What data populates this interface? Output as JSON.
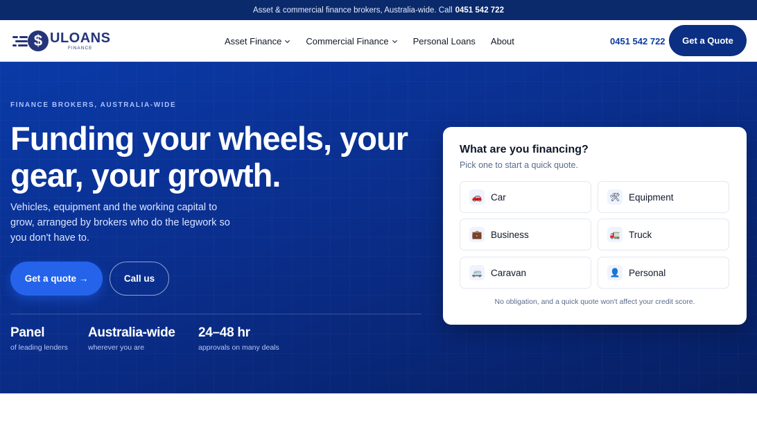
{
  "topbar": {
    "text": "Asset & commercial finance brokers, Australia-wide. Call",
    "phone": "0451 542 722"
  },
  "logo": {
    "mark": "$",
    "name": "ULOANS",
    "tagline": "FINANCE"
  },
  "nav": {
    "items": [
      {
        "label": "Asset Finance",
        "has_dropdown": true
      },
      {
        "label": "Commercial Finance",
        "has_dropdown": true
      },
      {
        "label": "Personal Loans",
        "has_dropdown": false
      },
      {
        "label": "About",
        "has_dropdown": false
      }
    ],
    "phone": "0451 542 722",
    "cta": "Get a Quote"
  },
  "hero": {
    "eyebrow": "FINANCE BROKERS, AUSTRALIA-WIDE",
    "headline_line1": "Funding your wheels, your",
    "headline_line2": "gear, your growth.",
    "subcopy": "Vehicles, equipment and the working capital to grow, arranged by brokers who do the legwork so you don't have to.",
    "primary_cta": "Get a quote →",
    "secondary_cta": "Call us",
    "stats": [
      {
        "value": "Panel",
        "label": "of leading lenders"
      },
      {
        "value": "Australia-wide",
        "label": "wherever you are"
      },
      {
        "value": "24–48 hr",
        "label": "approvals on many deals"
      }
    ]
  },
  "quote_card": {
    "title": "What are you financing?",
    "subtitle": "Pick one to start a quick quote.",
    "options": [
      {
        "label": "Car",
        "icon": "car-icon",
        "glyph": "🚗"
      },
      {
        "label": "Equipment",
        "icon": "tools-icon",
        "glyph": "🛠"
      },
      {
        "label": "Business",
        "icon": "briefcase-icon",
        "glyph": "💼"
      },
      {
        "label": "Truck",
        "icon": "truck-icon",
        "glyph": "🚛"
      },
      {
        "label": "Caravan",
        "icon": "caravan-icon",
        "glyph": "🚐"
      },
      {
        "label": "Personal",
        "icon": "person-icon",
        "glyph": "👤"
      }
    ],
    "note": "No obligation, and a quick quote won't affect your credit score."
  },
  "colors": {
    "topbar": "#0a2a6b",
    "brand": "#26347a",
    "hero_start": "#0a3aa8",
    "hero_end": "#071f62",
    "primary_button": "#2563eb",
    "header_cta": "#0b2f82",
    "phone": "#0a3ca0"
  }
}
